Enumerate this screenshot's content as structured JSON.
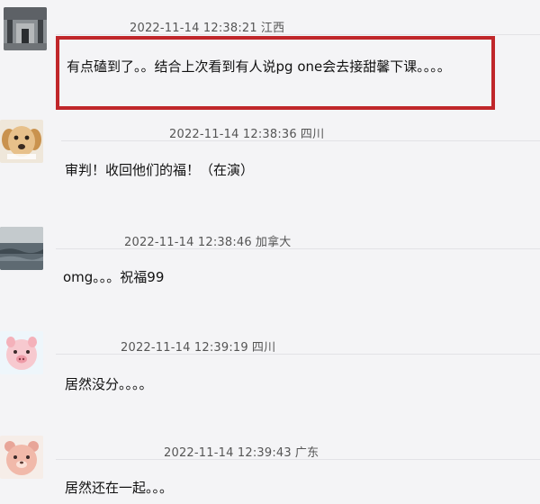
{
  "comments": [
    {
      "avatar_icon": "train-platform-photo-avatar",
      "timestamp": "2022-11-14 12:38:21",
      "location": "江西",
      "text": "有点磕到了。。结合上次看到有人说pg one会去接甜馨下课。。。。",
      "highlighted": true
    },
    {
      "avatar_icon": "golden-retriever-puppy-avatar",
      "timestamp": "2022-11-14 12:38:36",
      "location": "四川",
      "text": "审判！收回他们的福！（在演）",
      "highlighted": false
    },
    {
      "avatar_icon": "ocean-landscape-avatar",
      "timestamp": "2022-11-14 12:38:46",
      "location": "加拿大",
      "text": "omg。。。祝福99",
      "highlighted": false
    },
    {
      "avatar_icon": "cartoon-pig-avatar",
      "timestamp": "2022-11-14 12:39:19",
      "location": "四川",
      "text": "居然没分。。。。",
      "highlighted": false
    },
    {
      "avatar_icon": "cartoon-bear-avatar",
      "timestamp": "2022-11-14 12:39:43",
      "location": "广东",
      "text": "居然还在一起。。。",
      "highlighted": false
    }
  ],
  "colors": {
    "highlight_border": "#c0262a",
    "background": "#f4f4f6"
  }
}
